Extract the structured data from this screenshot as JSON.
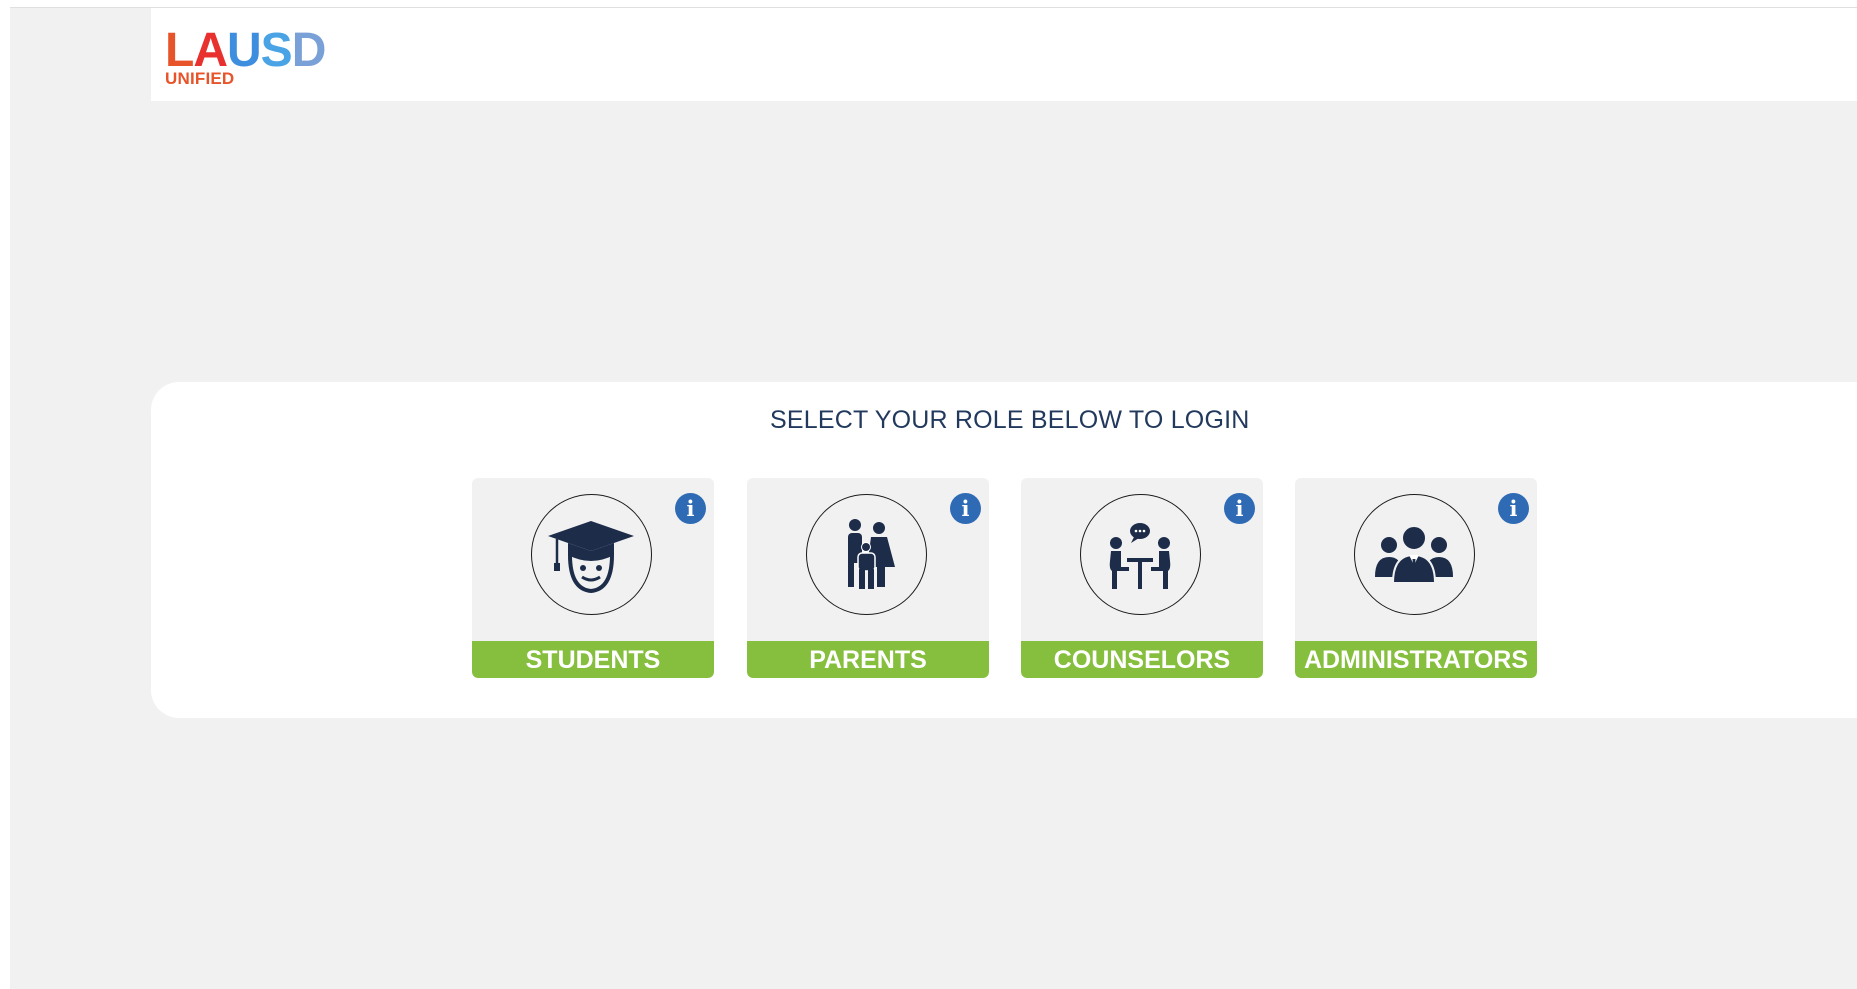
{
  "header": {
    "logo_main": [
      "L",
      "A",
      "U",
      "S",
      "D"
    ],
    "logo_sub": "UNIFIED"
  },
  "login": {
    "heading": "SELECT YOUR ROLE BELOW TO LOGIN",
    "info_glyph": "i",
    "roles": [
      {
        "label": "STUDENTS",
        "icon": "graduate-icon"
      },
      {
        "label": "PARENTS",
        "icon": "family-icon"
      },
      {
        "label": "COUNSELORS",
        "icon": "counseling-icon"
      },
      {
        "label": "ADMINISTRATORS",
        "icon": "group-icon"
      }
    ]
  },
  "colors": {
    "accent_green": "#86be3d",
    "info_blue": "#2f6bb5",
    "heading_navy": "#22395e",
    "icon_navy": "#1c2c49"
  }
}
